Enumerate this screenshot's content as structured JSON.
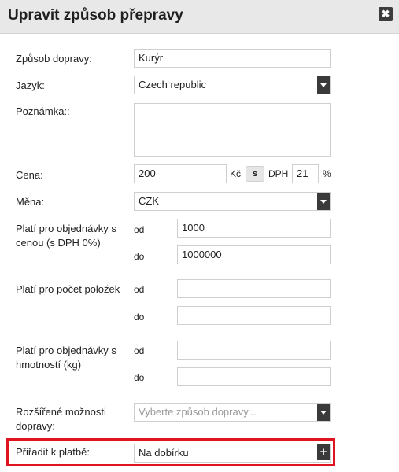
{
  "dialog": {
    "title": "Upravit způsob přepravy",
    "close_icon": "✖"
  },
  "form": {
    "method_label": "Způsob dopravy:",
    "method_value": "Kurýr",
    "language_label": "Jazyk:",
    "language_value": "Czech republic",
    "note_label": "Poznámka::",
    "note_value": "",
    "price_label": "Cena:",
    "price_value": "200",
    "currency_symbol": "Kč",
    "with_vat_button": "s",
    "vat_label": "DPH",
    "vat_value": "21",
    "percent_sign": "%",
    "currency_label": "Měna:",
    "currency_value": "CZK",
    "price_range_label": "Platí pro objednávky s cenou (s DPH 0%)",
    "price_from_label": "od",
    "price_from_value": "1000",
    "price_to_label": "do",
    "price_to_value": "1000000",
    "items_range_label": "Platí pro počet položek",
    "items_from_label": "od",
    "items_from_value": "",
    "items_to_label": "do",
    "items_to_value": "",
    "weight_range_label": "Platí pro objednávky s hmotností (kg)",
    "weight_from_label": "od",
    "weight_from_value": "",
    "weight_to_label": "do",
    "weight_to_value": "",
    "extended_label": "Rozšířené možnosti dopravy:",
    "extended_placeholder": "Vyberte způsob dopravy...",
    "payment_label": "Přiřadit k platbě:",
    "payment_value": "Na dobírku",
    "add_icon": "+"
  },
  "colors": {
    "highlight": "#e0141e",
    "header_bg": "#e8e8e8",
    "dark_control": "#3a3a3a"
  }
}
